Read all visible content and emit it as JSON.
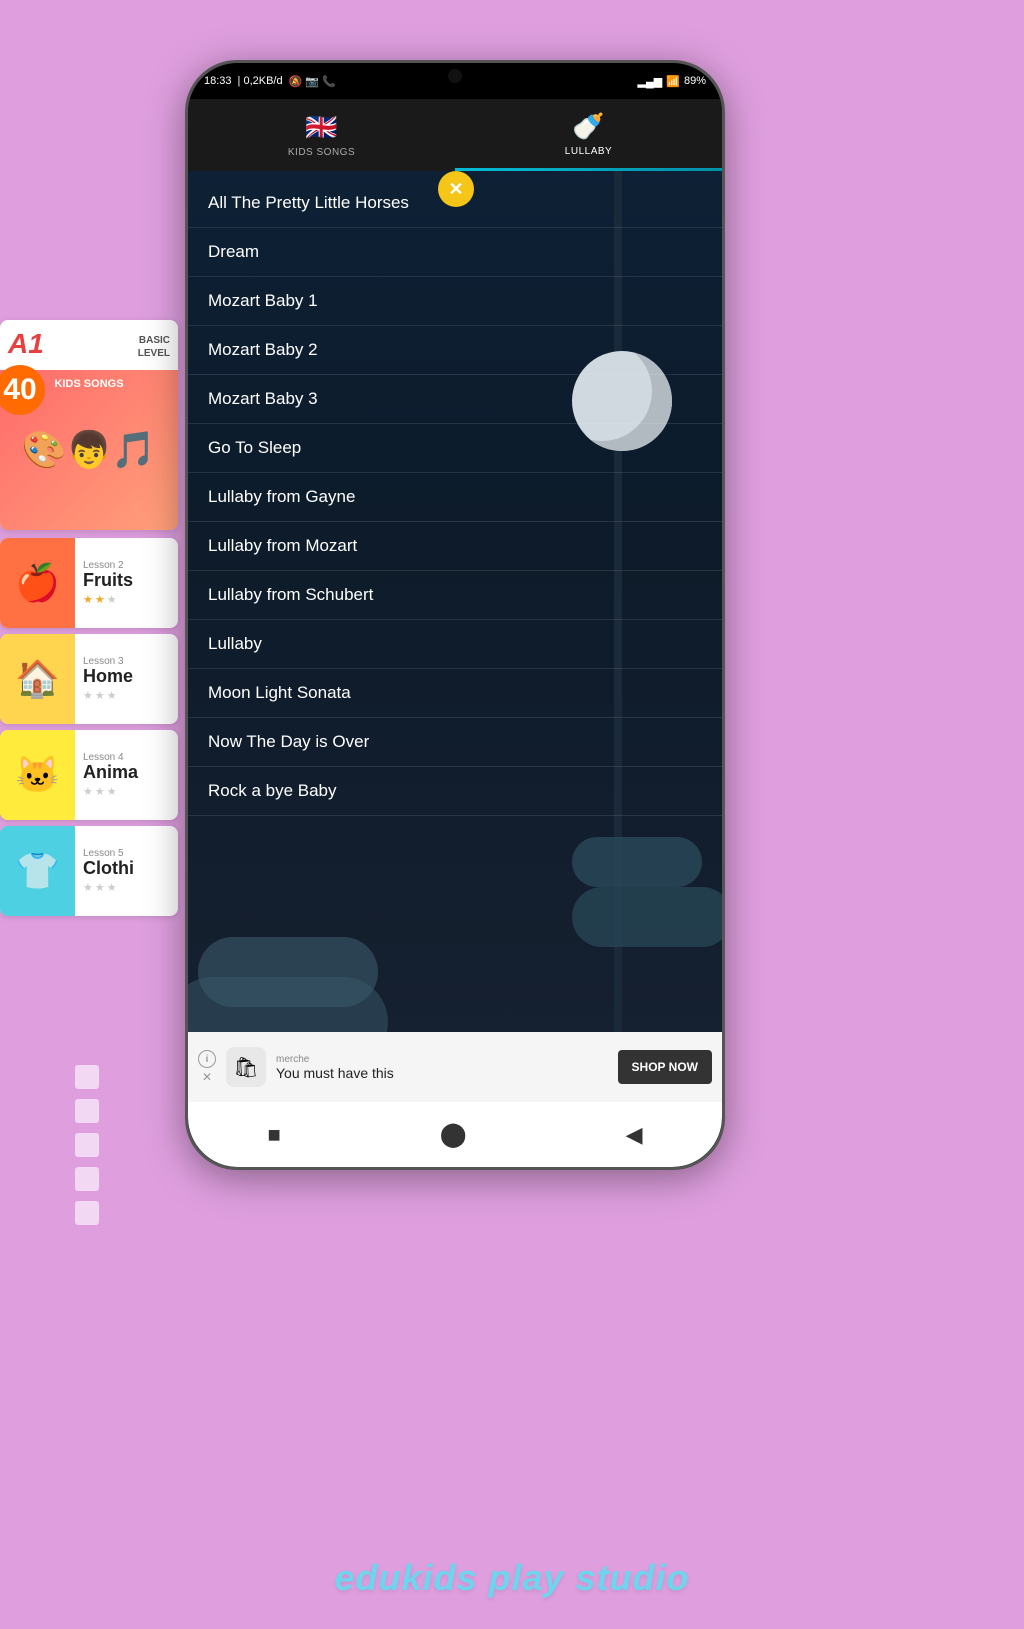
{
  "statusBar": {
    "time": "18:33",
    "network": "0,2KB/d",
    "batteryPercent": "89"
  },
  "tabs": [
    {
      "id": "kids-songs",
      "icon": "🇬🇧",
      "label": "KIDS SONGS",
      "active": false
    },
    {
      "id": "lullaby",
      "icon": "🍼",
      "label": "LULLABY",
      "active": true
    }
  ],
  "closeButton": "✕",
  "songs": [
    {
      "title": "All The Pretty Little Horses"
    },
    {
      "title": "Dream"
    },
    {
      "title": "Mozart Baby 1"
    },
    {
      "title": "Mozart Baby 2"
    },
    {
      "title": "Mozart Baby 3"
    },
    {
      "title": "Go To Sleep"
    },
    {
      "title": "Lullaby from Gayne"
    },
    {
      "title": "Lullaby from Mozart"
    },
    {
      "title": "Lullaby from Schubert"
    },
    {
      "title": "Lullaby"
    },
    {
      "title": "Moon Light Sonata"
    },
    {
      "title": "Now The Day is Over"
    },
    {
      "title": "Rock a bye Baby"
    }
  ],
  "ad": {
    "brand": "merche",
    "tagline": "You must have this",
    "shopButton": "SHOP NOW"
  },
  "bottomNav": {
    "square": "■",
    "circle": "○",
    "back": "◀"
  },
  "a1Card": {
    "badge": "A1",
    "basicLabel": "BASIC",
    "levelLabel": "LEVEL",
    "number": "40",
    "kidsSongsLabel": "KIDS SONGS"
  },
  "lessons": [
    {
      "num": "Lesson 2",
      "title": "Fruits",
      "stars": 2,
      "totalStars": 3,
      "bg": "#ff7043",
      "emoji": "🍎"
    },
    {
      "num": "Lesson 3",
      "title": "Home",
      "stars": 0,
      "totalStars": 3,
      "bg": "#ffd54f",
      "emoji": "🏠"
    },
    {
      "num": "Lesson 4",
      "title": "Anima",
      "stars": 0,
      "totalStars": 3,
      "bg": "#ffeb3b",
      "emoji": "🐱"
    },
    {
      "num": "Lesson 5",
      "title": "Clothi",
      "stars": 0,
      "totalStars": 3,
      "bg": "#4dd0e1",
      "emoji": "👕"
    }
  ],
  "branding": "edukids play studio",
  "dots": [
    1,
    2,
    3,
    4,
    5
  ]
}
